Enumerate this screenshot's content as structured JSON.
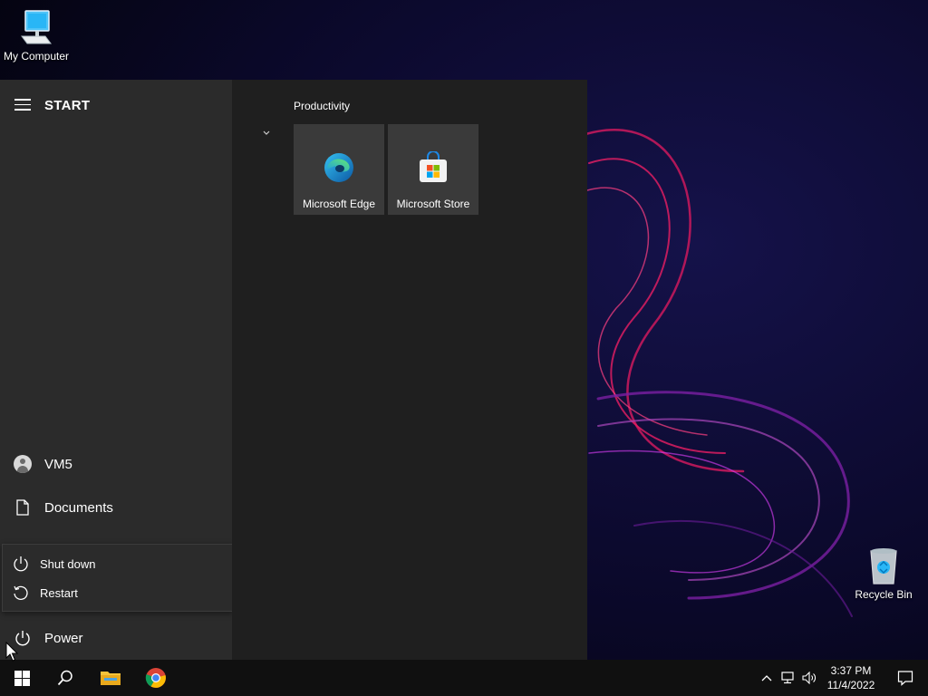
{
  "desktop": {
    "icons": [
      {
        "label": "My Computer",
        "icon": "computer-icon"
      },
      {
        "label": "Recycle Bin",
        "icon": "recycle-bin-icon"
      }
    ]
  },
  "start_menu": {
    "title": "START",
    "user": {
      "label": "VM5",
      "icon": "user-avatar-icon"
    },
    "documents": {
      "label": "Documents",
      "icon": "document-icon"
    },
    "power": {
      "label": "Power",
      "icon": "power-icon"
    },
    "power_menu": [
      {
        "label": "Shut down",
        "icon": "power-icon"
      },
      {
        "label": "Restart",
        "icon": "restart-icon"
      }
    ],
    "group": {
      "label": "Productivity",
      "tiles": [
        {
          "label": "Microsoft Edge",
          "icon": "edge-icon"
        },
        {
          "label": "Microsoft Store",
          "icon": "store-icon"
        }
      ]
    }
  },
  "taskbar": {
    "apps": [
      {
        "name": "Start",
        "icon": "windows-logo-icon"
      },
      {
        "name": "Search",
        "icon": "search-icon"
      },
      {
        "name": "File Explorer",
        "icon": "folder-icon"
      },
      {
        "name": "Google Chrome",
        "icon": "chrome-icon"
      }
    ],
    "tray": {
      "time": "3:37 PM",
      "date": "11/4/2022",
      "icons": [
        "chevron-up-icon",
        "network-icon",
        "volume-icon",
        "notification-icon"
      ]
    }
  },
  "colors": {
    "start_left_bg": "#2b2b2b",
    "start_right_bg": "#1f1f1f",
    "tile_bg": "#3a3a3a",
    "taskbar_bg": "#101010"
  }
}
